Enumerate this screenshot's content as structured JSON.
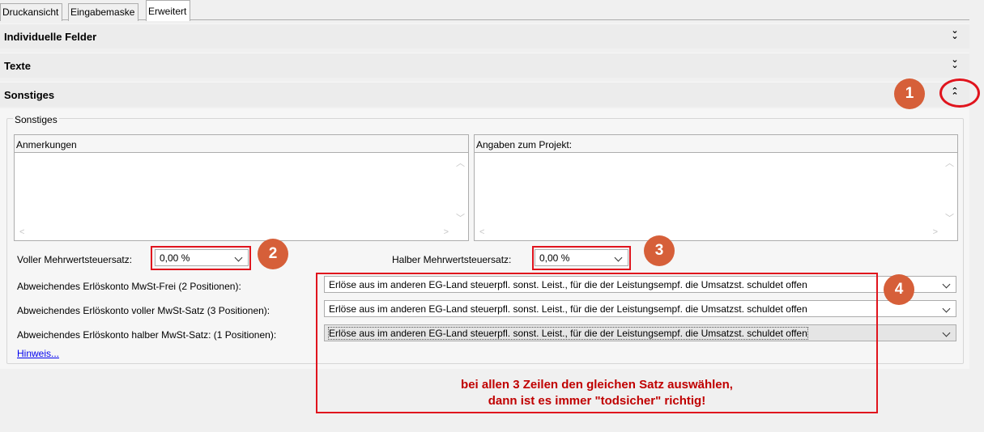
{
  "tabs": [
    {
      "label": "Druckansicht"
    },
    {
      "label": "Eingabemaske"
    },
    {
      "label": "Erweitert"
    }
  ],
  "sections": [
    {
      "title": "Individuelle Felder",
      "icon": "double-chevron-down"
    },
    {
      "title": "Texte",
      "icon": "double-chevron-down"
    },
    {
      "title": "Sonstiges",
      "icon": "double-chevron-up"
    }
  ],
  "group": {
    "legend": "Sonstiges",
    "anmerkungen_label": "Anmerkungen",
    "anmerkungen_value": "",
    "projekt_label": "Angaben zum Projekt:",
    "projekt_value": "",
    "voller_label": "Voller Mehrwertsteuersatz:",
    "voller_value": "0,00 %",
    "halber_label": "Halber Mehrwertsteuersatz:",
    "halber_value": "0,00 %",
    "rows": [
      {
        "label": "Abweichendes Erlöskonto MwSt-Frei (2 Positionen):",
        "value": "Erlöse aus im anderen EG-Land steuerpfl. sonst. Leist., für die der Leistungsempf. die Umsatzst. schuldet offen"
      },
      {
        "label": "Abweichendes Erlöskonto voller MwSt-Satz (3 Positionen):",
        "value": "Erlöse aus im anderen EG-Land steuerpfl. sonst. Leist., für die der Leistungsempf. die Umsatzst. schuldet offen"
      },
      {
        "label": "Abweichendes Erlöskonto halber MwSt-Satz: (1 Positionen):",
        "value": "Erlöse aus im anderen EG-Land steuerpfl. sonst. Leist., für die der Leistungsempf. die Umsatzst. schuldet offen"
      }
    ],
    "hinweis_link": "Hinweis..."
  },
  "annotations": {
    "badges": [
      "1",
      "2",
      "3",
      "4"
    ],
    "note_line1": "bei allen 3 Zeilen den gleichen Satz auswählen,",
    "note_line2": "dann ist es immer \"todsicher\" richtig!",
    "accent": "#e0141d",
    "badge_color": "#d65f39"
  }
}
